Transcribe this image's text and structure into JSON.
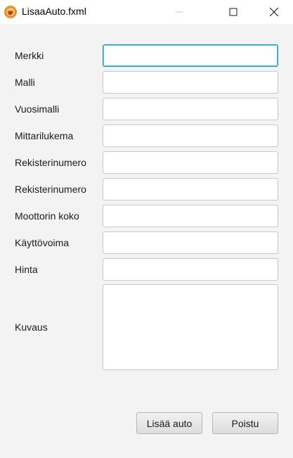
{
  "window": {
    "title": "LisaaAuto.fxml",
    "icon": "java-coffee-icon"
  },
  "form": {
    "fields": [
      {
        "label": "Merkki",
        "value": ""
      },
      {
        "label": "Malli",
        "value": ""
      },
      {
        "label": "Vuosimalli",
        "value": ""
      },
      {
        "label": "Mittarilukema",
        "value": ""
      },
      {
        "label": "Rekisterinumero",
        "value": ""
      },
      {
        "label": "Rekisterinumero",
        "value": ""
      },
      {
        "label": "Moottorin koko",
        "value": ""
      },
      {
        "label": "Käyttövoima",
        "value": ""
      },
      {
        "label": "Hinta",
        "value": ""
      }
    ],
    "description": {
      "label": "Kuvaus",
      "value": ""
    }
  },
  "buttons": {
    "add_label": "Lisää auto",
    "exit_label": "Poistu"
  },
  "colors": {
    "focus_border": "#039ed3",
    "background": "#f3f3f3"
  }
}
